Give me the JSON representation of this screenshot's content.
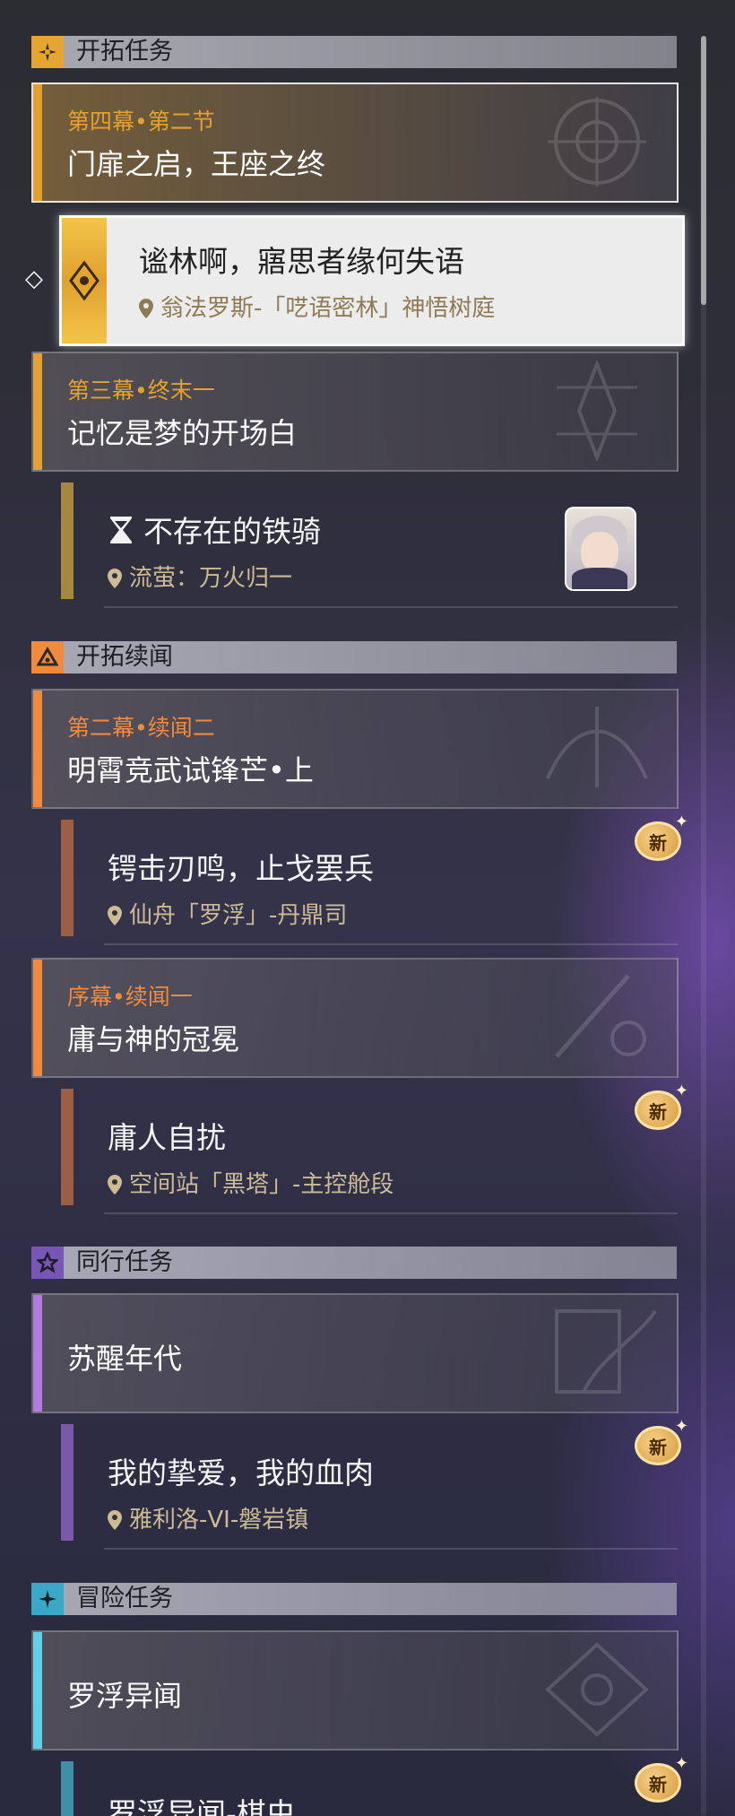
{
  "sections": {
    "trailblaze": {
      "title": "开拓任务",
      "icon": "trailblaze-icon"
    },
    "continuance": {
      "title": "开拓续闻",
      "icon": "continuance-icon"
    },
    "companion": {
      "title": "同行任务",
      "icon": "companion-star-icon"
    },
    "adventure": {
      "title": "冒险任务",
      "icon": "adventure-diamond-icon"
    }
  },
  "chapters": [
    {
      "sub": "第四幕•第二节",
      "title": "门扉之启，王座之终",
      "accent": "#e3a12f"
    },
    {
      "sub": "第三幕•终末一",
      "title": "记忆是梦的开场白",
      "accent": "#e3a12f"
    },
    {
      "sub": "第二幕•续闻二",
      "title": "明霄竞武试锋芒•上",
      "accent": "#f08a3c"
    },
    {
      "sub": "序幕•续闻一",
      "title": "庸与神的冠冕",
      "accent": "#f08a3c"
    },
    {
      "sub": "",
      "title": "苏醒年代",
      "accent": "#b57ae0"
    },
    {
      "sub": "",
      "title": "罗浮异闻",
      "accent": "#5fd0e8"
    }
  ],
  "quests": [
    {
      "name": "谧林啊，寤思者缘何失语",
      "location": "翁法罗斯-「呓语密林」神悟树庭",
      "selected": true
    },
    {
      "name": "不存在的铁骑",
      "location": "流萤：万火归一",
      "icon": "hourglass-icon",
      "avatar": "firefly-avatar"
    },
    {
      "name": "锷击刃鸣，止戈罢兵",
      "location": "仙舟「罗浮」-丹鼎司",
      "badge": "新"
    },
    {
      "name": "庸人自扰",
      "location": "空间站「黑塔」-主控舱段",
      "badge": "新"
    },
    {
      "name": "我的挚爱，我的血肉",
      "location": "雅利洛-VI-磐岩镇",
      "badge": "新"
    },
    {
      "name": "罗浮异闻-棋虫",
      "location": "",
      "badge": "新"
    }
  ],
  "colors": {
    "gold": "#e3a12f",
    "orange": "#f08a3c",
    "purple": "#b57ae0",
    "cyan": "#5fd0e8",
    "location_text": "#cdbb97"
  }
}
